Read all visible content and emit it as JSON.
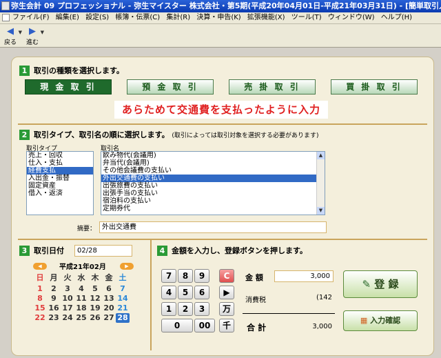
{
  "window": {
    "title": "弥生会計 09 プロフェッショナル - 弥生マイスター 株式会社・第5期(平成20年04月01日-平成21年03月31日) - [簡単取引入力]"
  },
  "menu": [
    "ファイル(F)",
    "編集(E)",
    "設定(S)",
    "帳簿・伝票(C)",
    "集計(R)",
    "決算・申告(K)",
    "拡張機能(X)",
    "ツール(T)",
    "ウィンドウ(W)",
    "ヘルプ(H)"
  ],
  "toolbar": {
    "back_label": "戻る",
    "forward_label": "進む"
  },
  "section1": {
    "number": "1",
    "heading": "取引の種類を選択します。",
    "types": [
      "現 金 取 引",
      "預 金 取 引",
      "売 掛 取 引",
      "買 掛 取 引"
    ],
    "annotation": "あらためて交通費を支払ったように入力"
  },
  "section2": {
    "number": "2",
    "heading": "取引タイプ、取引名の順に選択します。",
    "note": "(取引によっては取引対象を選択する必要があります)",
    "type_label": "取引タイプ",
    "name_label": "取引名",
    "types": [
      "売上・回収",
      "仕入・支払",
      "経費支払",
      "入出金・振替",
      "固定資産",
      "借入・返済"
    ],
    "names": [
      "飲み物代(会議用)",
      "弁当代(会議用)",
      "その他会議費の支払い",
      "外出交通費の支払い",
      "出張旅費の支払い",
      "出張手当の支払い",
      "宿泊料の支払い",
      "定期券代"
    ],
    "memo_label": "摘要：",
    "memo_value": "外出交通費"
  },
  "section3": {
    "number": "3",
    "heading": "取引日付",
    "date_value": "02/28",
    "month_title": "平成21年02月",
    "weekdays": [
      "日",
      "月",
      "火",
      "水",
      "木",
      "金",
      "土"
    ],
    "weeks": [
      [
        "1",
        "2",
        "3",
        "4",
        "5",
        "6",
        "7"
      ],
      [
        "8",
        "9",
        "10",
        "11",
        "12",
        "13",
        "14"
      ],
      [
        "15",
        "16",
        "17",
        "18",
        "19",
        "20",
        "21"
      ],
      [
        "22",
        "23",
        "24",
        "25",
        "26",
        "27",
        "28"
      ]
    ]
  },
  "section4": {
    "number": "4",
    "heading": "金額を入力し、登録ボタンを押します。",
    "keys": [
      "7",
      "8",
      "9",
      "C",
      "4",
      "5",
      "6",
      "▶",
      "1",
      "2",
      "3",
      "万",
      "0",
      "00",
      "千"
    ],
    "amount_label": "金 額",
    "amount_value": "3,000",
    "tax_label": "消費税",
    "tax_value": "(142",
    "total_label": "合 計",
    "total_value": "3,000",
    "register_label": "登 録",
    "confirm_label": "入力確認"
  },
  "colors": {
    "accent_green": "#2a9a36",
    "selected": "#316ac5",
    "annotation_red": "#e02020"
  }
}
